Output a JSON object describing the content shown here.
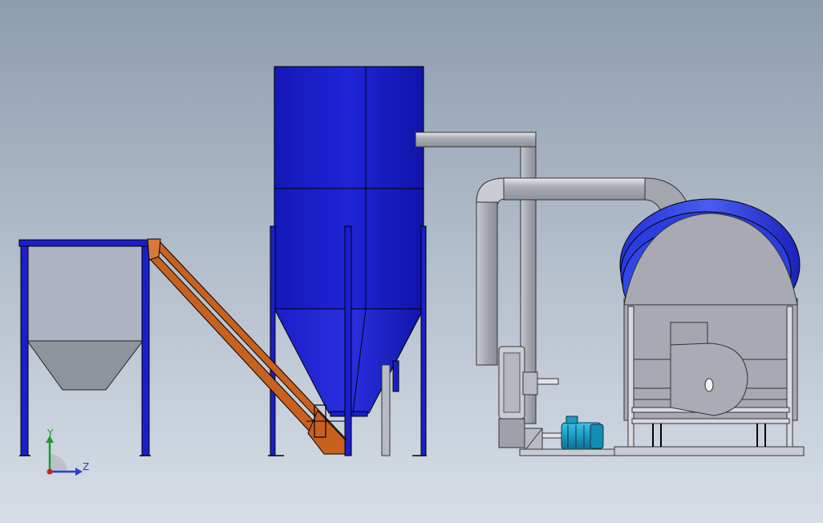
{
  "triad": {
    "y_label": "Y",
    "z_label": "Z",
    "y_color": "#1f9a2a",
    "z_color": "#2a3fd0",
    "x_color": "#d02020"
  },
  "colors": {
    "equipment_blue": "#1a1fc9",
    "conveyor_orange": "#c8601e",
    "steel_grey": "#a7aab3",
    "motor_teal": "#1aa0c8"
  }
}
